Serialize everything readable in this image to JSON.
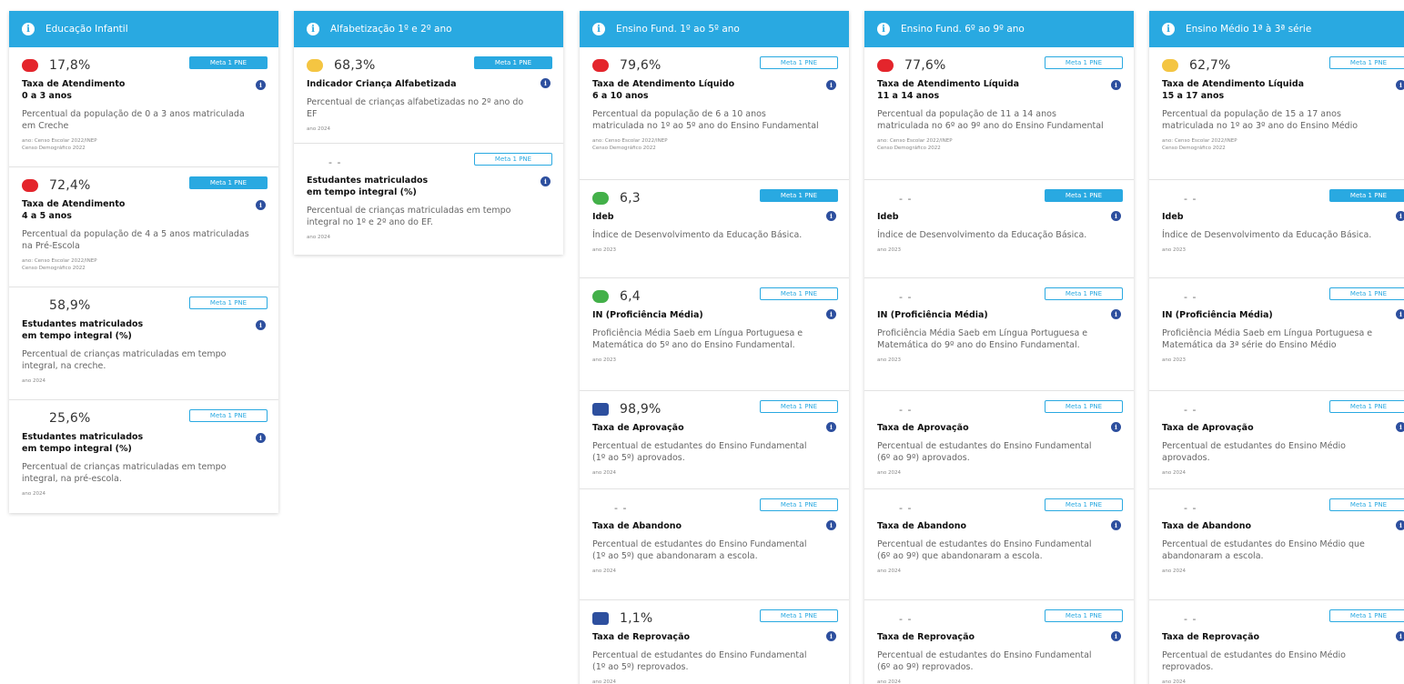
{
  "badge_label": "Meta 1 PNE",
  "info_glyph": "i",
  "colors": {
    "header": "#29a9e1",
    "red": "#e4252c",
    "yellow": "#f4c542",
    "green": "#43b049",
    "blue": "#2d4f9e"
  },
  "columns": [
    {
      "title": "Educação Infantil",
      "cards": [
        {
          "value": "17,8%",
          "status": "red",
          "shape": "round",
          "badge_filled": true,
          "title": "Taxa de Atendimento\n0 a 3 anos",
          "desc": "Percentual da população de 0 a 3 anos matriculada em Creche",
          "source": "ano: Censo Escolar 2022/INEP\nCenso Demográfico 2022"
        },
        {
          "value": "72,4%",
          "status": "red",
          "shape": "round",
          "badge_filled": true,
          "title": "Taxa de Atendimento\n4 a 5 anos",
          "desc": "Percentual da população de 4 a 5 anos matriculadas na Pré-Escola",
          "source": "ano: Censo Escolar 2022/INEP\nCenso Demográfico 2022"
        },
        {
          "value": "58,9%",
          "status": "none",
          "shape": "round",
          "badge_filled": false,
          "title": "Estudantes matriculados\nem tempo integral (%)",
          "desc": "Percentual de crianças matriculadas em tempo integral, na creche.",
          "source": "ano 2024"
        },
        {
          "value": "25,6%",
          "status": "none",
          "shape": "round",
          "badge_filled": false,
          "title": "Estudantes matriculados\nem tempo integral (%)",
          "desc": "Percentual de crianças matriculadas em tempo integral, na pré-escola.",
          "source": "ano 2024"
        }
      ]
    },
    {
      "title": "Alfabetização 1º e 2º ano",
      "cards": [
        {
          "value": "68,3%",
          "status": "yellow",
          "shape": "round",
          "badge_filled": true,
          "title": "Indicador Criança Alfabetizada",
          "desc": "Percentual de crianças alfabetizadas no 2º ano do EF",
          "source": "ano 2024"
        },
        {
          "value": "- -",
          "status": "none",
          "shape": "round",
          "badge_filled": false,
          "title": "Estudantes matriculados\nem tempo integral (%)",
          "desc": "Percentual de crianças matriculadas em tempo integral no 1º e 2º ano do EF.",
          "source": "ano 2024"
        }
      ]
    },
    {
      "title": "Ensino Fund. 1º ao 5º ano",
      "cards": [
        {
          "value": "79,6%",
          "status": "red",
          "shape": "round",
          "badge_filled": false,
          "title": "Taxa de Atendimento Líquido\n6 a 10 anos",
          "desc": "Percentual da população de 6 a 10 anos matriculada no 1º ao 5º ano do Ensino Fundamental",
          "source": "ano: Censo Escolar 2022/INEP\nCenso Demográfico 2022"
        },
        {
          "value": "6,3",
          "status": "green",
          "shape": "round",
          "badge_filled": true,
          "title": "Ideb",
          "desc": "Índice de Desenvolvimento da Educação Básica.",
          "source": "ano 2023"
        },
        {
          "value": "6,4",
          "status": "green",
          "shape": "round",
          "badge_filled": false,
          "title": "IN (Proficiência Média)",
          "desc": "Proficiência Média Saeb em Língua Portuguesa e Matemática do 5º ano do Ensino Fundamental.",
          "source": "ano 2023"
        },
        {
          "value": "98,9%",
          "status": "blue",
          "shape": "square",
          "badge_filled": false,
          "title": "Taxa de Aprovação",
          "desc": "Percentual de estudantes do Ensino Fundamental (1º ao 5º) aprovados.",
          "source": "ano 2024"
        },
        {
          "value": "- -",
          "status": "none",
          "shape": "round",
          "badge_filled": false,
          "title": "Taxa de Abandono",
          "desc": "Percentual de estudantes do Ensino Fundamental (1º ao 5º) que abandonaram a escola.",
          "source": "ano 2024"
        },
        {
          "value": "1,1%",
          "status": "blue",
          "shape": "square",
          "badge_filled": false,
          "title": "Taxa de Reprovação",
          "desc": "Percentual de estudantes do Ensino Fundamental (1º ao 5º) reprovados.",
          "source": "ano 2024"
        }
      ]
    },
    {
      "title": "Ensino Fund. 6º ao 9º ano",
      "cards": [
        {
          "value": "77,6%",
          "status": "red",
          "shape": "round",
          "badge_filled": false,
          "title": "Taxa de Atendimento Líquida\n11 a 14 anos",
          "desc": "Percentual da população de 11 a 14 anos matriculada no 6º ao 9º ano do Ensino Fundamental",
          "source": "ano: Censo Escolar 2022/INEP\nCenso Demográfico 2022"
        },
        {
          "value": "- -",
          "status": "none",
          "shape": "round",
          "badge_filled": true,
          "title": "Ideb",
          "desc": "Índice de Desenvolvimento da Educação Básica.",
          "source": "ano 2023"
        },
        {
          "value": "- -",
          "status": "none",
          "shape": "round",
          "badge_filled": false,
          "title": "IN (Proficiência Média)",
          "desc": "Proficiência Média Saeb em Língua Portuguesa e Matemática do 9º ano do Ensino Fundamental.",
          "source": "ano 2023"
        },
        {
          "value": "- -",
          "status": "none",
          "shape": "round",
          "badge_filled": false,
          "title": "Taxa de Aprovação",
          "desc": "Percentual de estudantes do Ensino Fundamental (6º ao 9º) aprovados.",
          "source": "ano 2024"
        },
        {
          "value": "- -",
          "status": "none",
          "shape": "round",
          "badge_filled": false,
          "title": "Taxa de Abandono",
          "desc": "Percentual de estudantes do Ensino Fundamental (6º ao 9º) que abandonaram a escola.",
          "source": "ano 2024"
        },
        {
          "value": "- -",
          "status": "none",
          "shape": "round",
          "badge_filled": false,
          "title": "Taxa de Reprovação",
          "desc": "Percentual de estudantes do Ensino Fundamental (6º ao 9º) reprovados.",
          "source": "ano 2024"
        }
      ]
    },
    {
      "title": "Ensino Médio 1ª à 3ª série",
      "cards": [
        {
          "value": "62,7%",
          "status": "yellow",
          "shape": "round",
          "badge_filled": false,
          "title": "Taxa de Atendimento Líquida\n15 a 17 anos",
          "desc": "Percentual da população de 15 a 17 anos matriculada no 1º ao 3º ano do Ensino Médio",
          "source": "ano: Censo Escolar 2022/INEP\nCenso Demográfico 2022"
        },
        {
          "value": "- -",
          "status": "none",
          "shape": "round",
          "badge_filled": true,
          "title": "Ideb",
          "desc": "Índice de Desenvolvimento da Educação Básica.",
          "source": "ano 2023"
        },
        {
          "value": "- -",
          "status": "none",
          "shape": "round",
          "badge_filled": false,
          "title": "IN (Proficiência Média)",
          "desc": "Proficiência Média Saeb em Língua Portuguesa e Matemática da 3ª série do Ensino Médio",
          "source": "ano 2023"
        },
        {
          "value": "- -",
          "status": "none",
          "shape": "round",
          "badge_filled": false,
          "title": "Taxa de Aprovação",
          "desc": "Percentual de estudantes do Ensino Médio aprovados.",
          "source": "ano 2024"
        },
        {
          "value": "- -",
          "status": "none",
          "shape": "round",
          "badge_filled": false,
          "title": "Taxa de Abandono",
          "desc": "Percentual de estudantes do Ensino Médio que abandonaram a escola.",
          "source": "ano 2024"
        },
        {
          "value": "- -",
          "status": "none",
          "shape": "round",
          "badge_filled": false,
          "title": "Taxa de Reprovação",
          "desc": "Percentual de estudantes do Ensino Médio reprovados.",
          "source": "ano 2024"
        }
      ]
    }
  ]
}
